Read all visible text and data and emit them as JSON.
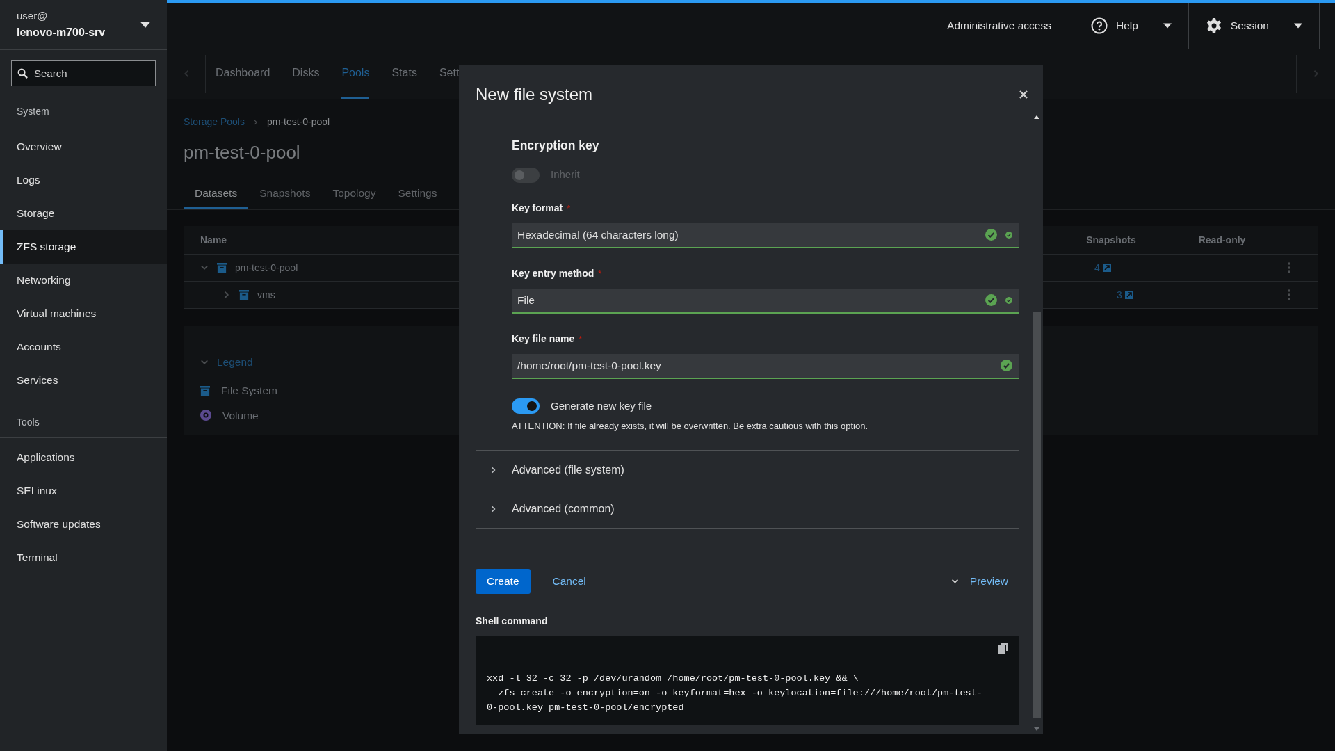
{
  "host": {
    "user": "user@",
    "name": "lenovo-m700-srv"
  },
  "search": {
    "placeholder": "Search"
  },
  "sidebar": {
    "sections": [
      {
        "heading": "System",
        "items": [
          {
            "label": "Overview",
            "selected": false
          },
          {
            "label": "Logs",
            "selected": false
          },
          {
            "label": "Storage",
            "selected": false
          },
          {
            "label": "ZFS storage",
            "selected": true
          },
          {
            "label": "Networking",
            "selected": false
          },
          {
            "label": "Virtual machines",
            "selected": false
          },
          {
            "label": "Accounts",
            "selected": false
          },
          {
            "label": "Services",
            "selected": false
          }
        ]
      },
      {
        "heading": "Tools",
        "items": [
          {
            "label": "Applications",
            "selected": false
          },
          {
            "label": "SELinux",
            "selected": false
          },
          {
            "label": "Software updates",
            "selected": false
          },
          {
            "label": "Terminal",
            "selected": false
          }
        ]
      }
    ]
  },
  "topbar": {
    "access": "Administrative access",
    "help": "Help",
    "session": "Session"
  },
  "page": {
    "tabs": [
      {
        "label": "Dashboard",
        "selected": false
      },
      {
        "label": "Disks",
        "selected": false
      },
      {
        "label": "Pools",
        "selected": true
      },
      {
        "label": "Stats",
        "selected": false
      },
      {
        "label": "Sett",
        "selected": false
      }
    ],
    "breadcrumb": [
      "Storage Pools",
      "pm-test-0-pool"
    ],
    "title": "pm-test-0-pool",
    "subtabs": [
      {
        "label": "Datasets",
        "selected": true
      },
      {
        "label": "Snapshots",
        "selected": false
      },
      {
        "label": "Topology",
        "selected": false
      },
      {
        "label": "Settings",
        "selected": false
      }
    ],
    "table": {
      "columns": [
        "Name",
        "Snapshots",
        "Read-only"
      ],
      "rows": [
        {
          "name": "pm-test-0-pool",
          "expanded": true,
          "snapshots": "4",
          "children": [
            {
              "name": "vms",
              "expanded": false,
              "snapshots": "3"
            }
          ]
        }
      ]
    },
    "legend": {
      "title": "Legend",
      "expanded": true,
      "items": [
        {
          "kind": "filesystem",
          "label": "File System"
        },
        {
          "kind": "volume",
          "label": "Volume"
        }
      ]
    }
  },
  "dialog": {
    "title": "New file system",
    "section": "Encryption key",
    "required_mark": "*",
    "inherit": {
      "label": "Inherit",
      "on": false,
      "disabled": true
    },
    "fields": [
      {
        "kind": "select",
        "label": "Key format",
        "required": true,
        "value": "Hexadecimal (64 characters long)"
      },
      {
        "kind": "select",
        "label": "Key entry method",
        "required": true,
        "value": "File"
      },
      {
        "kind": "text",
        "label": "Key file name",
        "required": true,
        "value": "/home/root/pm-test-0-pool.key"
      }
    ],
    "generate": {
      "label": "Generate new key file",
      "on": true,
      "disabled": false
    },
    "warning": "ATTENTION: If file already exists, it will be overwritten. Be extra cautious with this option.",
    "expanders": [
      {
        "label": "Advanced (file system)",
        "expanded": false
      },
      {
        "label": "Advanced (common)",
        "expanded": false
      }
    ],
    "create": "Create",
    "cancel": "Cancel",
    "preview": {
      "label": "Preview",
      "expanded": true
    },
    "shell": {
      "label": "Shell command",
      "lines": [
        "xxd -l 32 -c 32 -p /dev/urandom /home/root/pm-test-0-pool.key && \\",
        "  zfs create -o encryption=on -o keyformat=hex -o keylocation=file:///home/root/pm-test-",
        "0-pool.key pm-test-0-pool/encrypted"
      ]
    }
  }
}
